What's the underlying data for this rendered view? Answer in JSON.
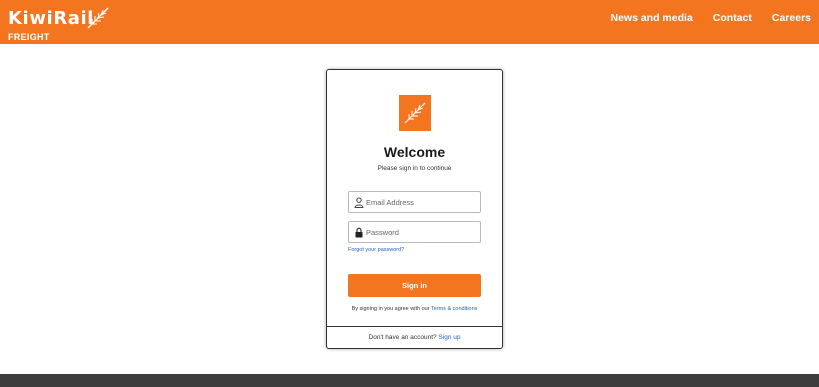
{
  "header": {
    "brand_name": "KiwiRail",
    "brand_sub": "FREIGHT",
    "nav": [
      "News and media",
      "Contact",
      "Careers"
    ]
  },
  "card": {
    "title": "Welcome",
    "subtitle": "Please sign in to continue",
    "email_placeholder": "Email Address",
    "password_placeholder": "Password",
    "forgot_label": "Forgot your password?",
    "signin_label": "Sign in",
    "terms_prefix": "By signing in you agree with our ",
    "terms_link": "Terms & conditions",
    "signup_prefix": "Don't have an account? ",
    "signup_link": "Sign up"
  },
  "colors": {
    "brand_orange": "#f47520",
    "link_blue": "#1f5fd6",
    "footer_gray": "#3d3d3d"
  },
  "icons": [
    "fern-icon",
    "user-icon",
    "lock-icon"
  ]
}
